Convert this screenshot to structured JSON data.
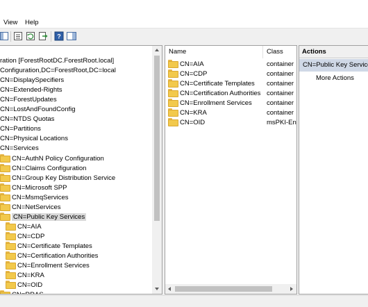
{
  "menu": {
    "view": "View",
    "help": "Help"
  },
  "tree": {
    "items": [
      {
        "label": "ration [ForestRootDC.ForestRoot.local]",
        "indent": 0,
        "folder": false
      },
      {
        "label": "Configuration,DC=ForestRoot,DC=local",
        "indent": 0,
        "folder": false
      },
      {
        "label": "CN=DisplaySpecifiers",
        "indent": 0,
        "folder": false
      },
      {
        "label": "CN=Extended-Rights",
        "indent": 0,
        "folder": false
      },
      {
        "label": "CN=ForestUpdates",
        "indent": 0,
        "folder": false
      },
      {
        "label": "CN=LostAndFoundConfig",
        "indent": 0,
        "folder": false
      },
      {
        "label": "CN=NTDS Quotas",
        "indent": 0,
        "folder": false
      },
      {
        "label": "CN=Partitions",
        "indent": 0,
        "folder": false
      },
      {
        "label": "CN=Physical Locations",
        "indent": 0,
        "folder": false
      },
      {
        "label": "CN=Services",
        "indent": 0,
        "folder": false
      },
      {
        "label": "CN=AuthN Policy Configuration",
        "indent": 1,
        "folder": true
      },
      {
        "label": "CN=Claims Configuration",
        "indent": 1,
        "folder": true
      },
      {
        "label": "CN=Group Key Distribution Service",
        "indent": 1,
        "folder": true
      },
      {
        "label": "CN=Microsoft SPP",
        "indent": 1,
        "folder": true
      },
      {
        "label": "CN=MsmqServices",
        "indent": 1,
        "folder": true
      },
      {
        "label": "CN=NetServices",
        "indent": 1,
        "folder": true
      },
      {
        "label": "CN=Public Key Services",
        "indent": 1,
        "folder": true,
        "selected": true
      },
      {
        "label": "CN=AIA",
        "indent": 2,
        "folder": true
      },
      {
        "label": "CN=CDP",
        "indent": 2,
        "folder": true
      },
      {
        "label": "CN=Certificate Templates",
        "indent": 2,
        "folder": true
      },
      {
        "label": "CN=Certification Authorities",
        "indent": 2,
        "folder": true
      },
      {
        "label": "CN=Enrollment Services",
        "indent": 2,
        "folder": true
      },
      {
        "label": "CN=KRA",
        "indent": 2,
        "folder": true
      },
      {
        "label": "CN=OID",
        "indent": 2,
        "folder": true
      },
      {
        "label": "CN=RRAS",
        "indent": 1,
        "folder": true
      }
    ]
  },
  "list": {
    "columns": {
      "name": "Name",
      "class": "Class"
    },
    "rows": [
      {
        "name": "CN=AIA",
        "class": "container"
      },
      {
        "name": "CN=CDP",
        "class": "container"
      },
      {
        "name": "CN=Certificate Templates",
        "class": "container"
      },
      {
        "name": "CN=Certification Authorities",
        "class": "container"
      },
      {
        "name": "CN=Enrollment Services",
        "class": "container"
      },
      {
        "name": "CN=KRA",
        "class": "container"
      },
      {
        "name": "CN=OID",
        "class": "msPKI-Ent"
      }
    ]
  },
  "actions": {
    "header": "Actions",
    "section": "CN=Public Key Services",
    "more": "More Actions"
  },
  "colors": {
    "folder": "#f2c94c",
    "selection": "#d9d9d9",
    "actions_section": "#cfd8e6"
  }
}
